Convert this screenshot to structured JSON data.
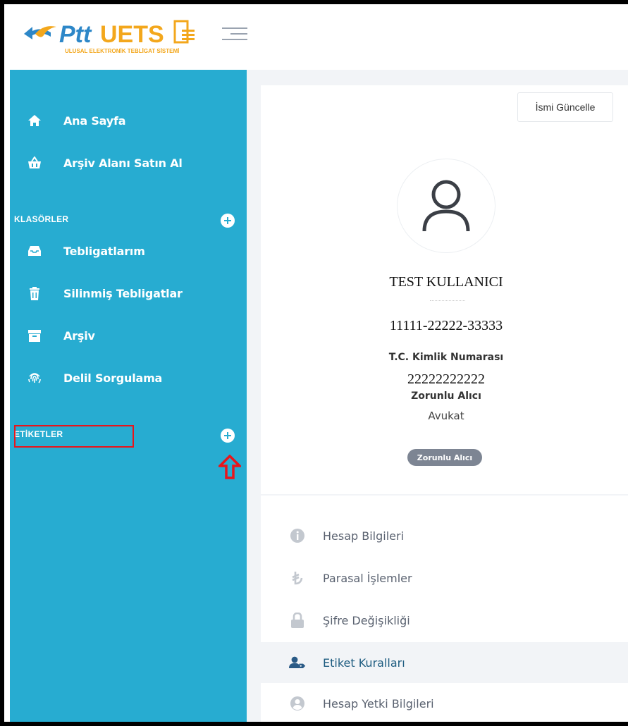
{
  "header": {
    "logo_brand": "Ptt",
    "logo_product": "UETS",
    "logo_subtitle": "ULUSAL ELEKTRONİK TEBLİGAT SİSTEMİ",
    "menu_icon": "hamburger-icon"
  },
  "sidebar": {
    "items_top": [
      {
        "label": "Ana Sayfa",
        "icon": "home-icon"
      },
      {
        "label": "Arşiv Alanı Satın Al",
        "icon": "basket-icon"
      }
    ],
    "folders_title": "KLASÖRLER",
    "folders": [
      {
        "label": "Tebligatlarım",
        "icon": "inbox-icon"
      },
      {
        "label": "Silinmiş Tebligatlar",
        "icon": "trash-icon"
      },
      {
        "label": "Arşiv",
        "icon": "archive-icon"
      },
      {
        "label": "Delil Sorgulama",
        "icon": "fingerprint-icon"
      }
    ],
    "labels_title": "ETİKETLER",
    "colors": {
      "background": "#27acd1",
      "highlight": "#e8151b"
    }
  },
  "profile": {
    "update_button": "İsmi Güncelle",
    "name": "TEST KULLANICI",
    "phone": "11111-22222-33333",
    "tc_label": "T.C. Kimlik Numarası",
    "tc_value": "22222222222",
    "role_label": "Zorunlu Alıcı",
    "profession": "Avukat",
    "badge": "Zorunlu Alıcı"
  },
  "account_menu": [
    {
      "label": "Hesap Bilgileri",
      "icon": "info-icon",
      "active": false
    },
    {
      "label": "Parasal İşlemler",
      "icon": "lira-icon",
      "active": false
    },
    {
      "label": "Şifre Değişikliği",
      "icon": "lock-icon",
      "active": false
    },
    {
      "label": "Etiket Kuralları",
      "icon": "user-tag-icon",
      "active": true
    },
    {
      "label": "Hesap Yetki Bilgileri",
      "icon": "user-circle-icon",
      "active": false
    }
  ]
}
